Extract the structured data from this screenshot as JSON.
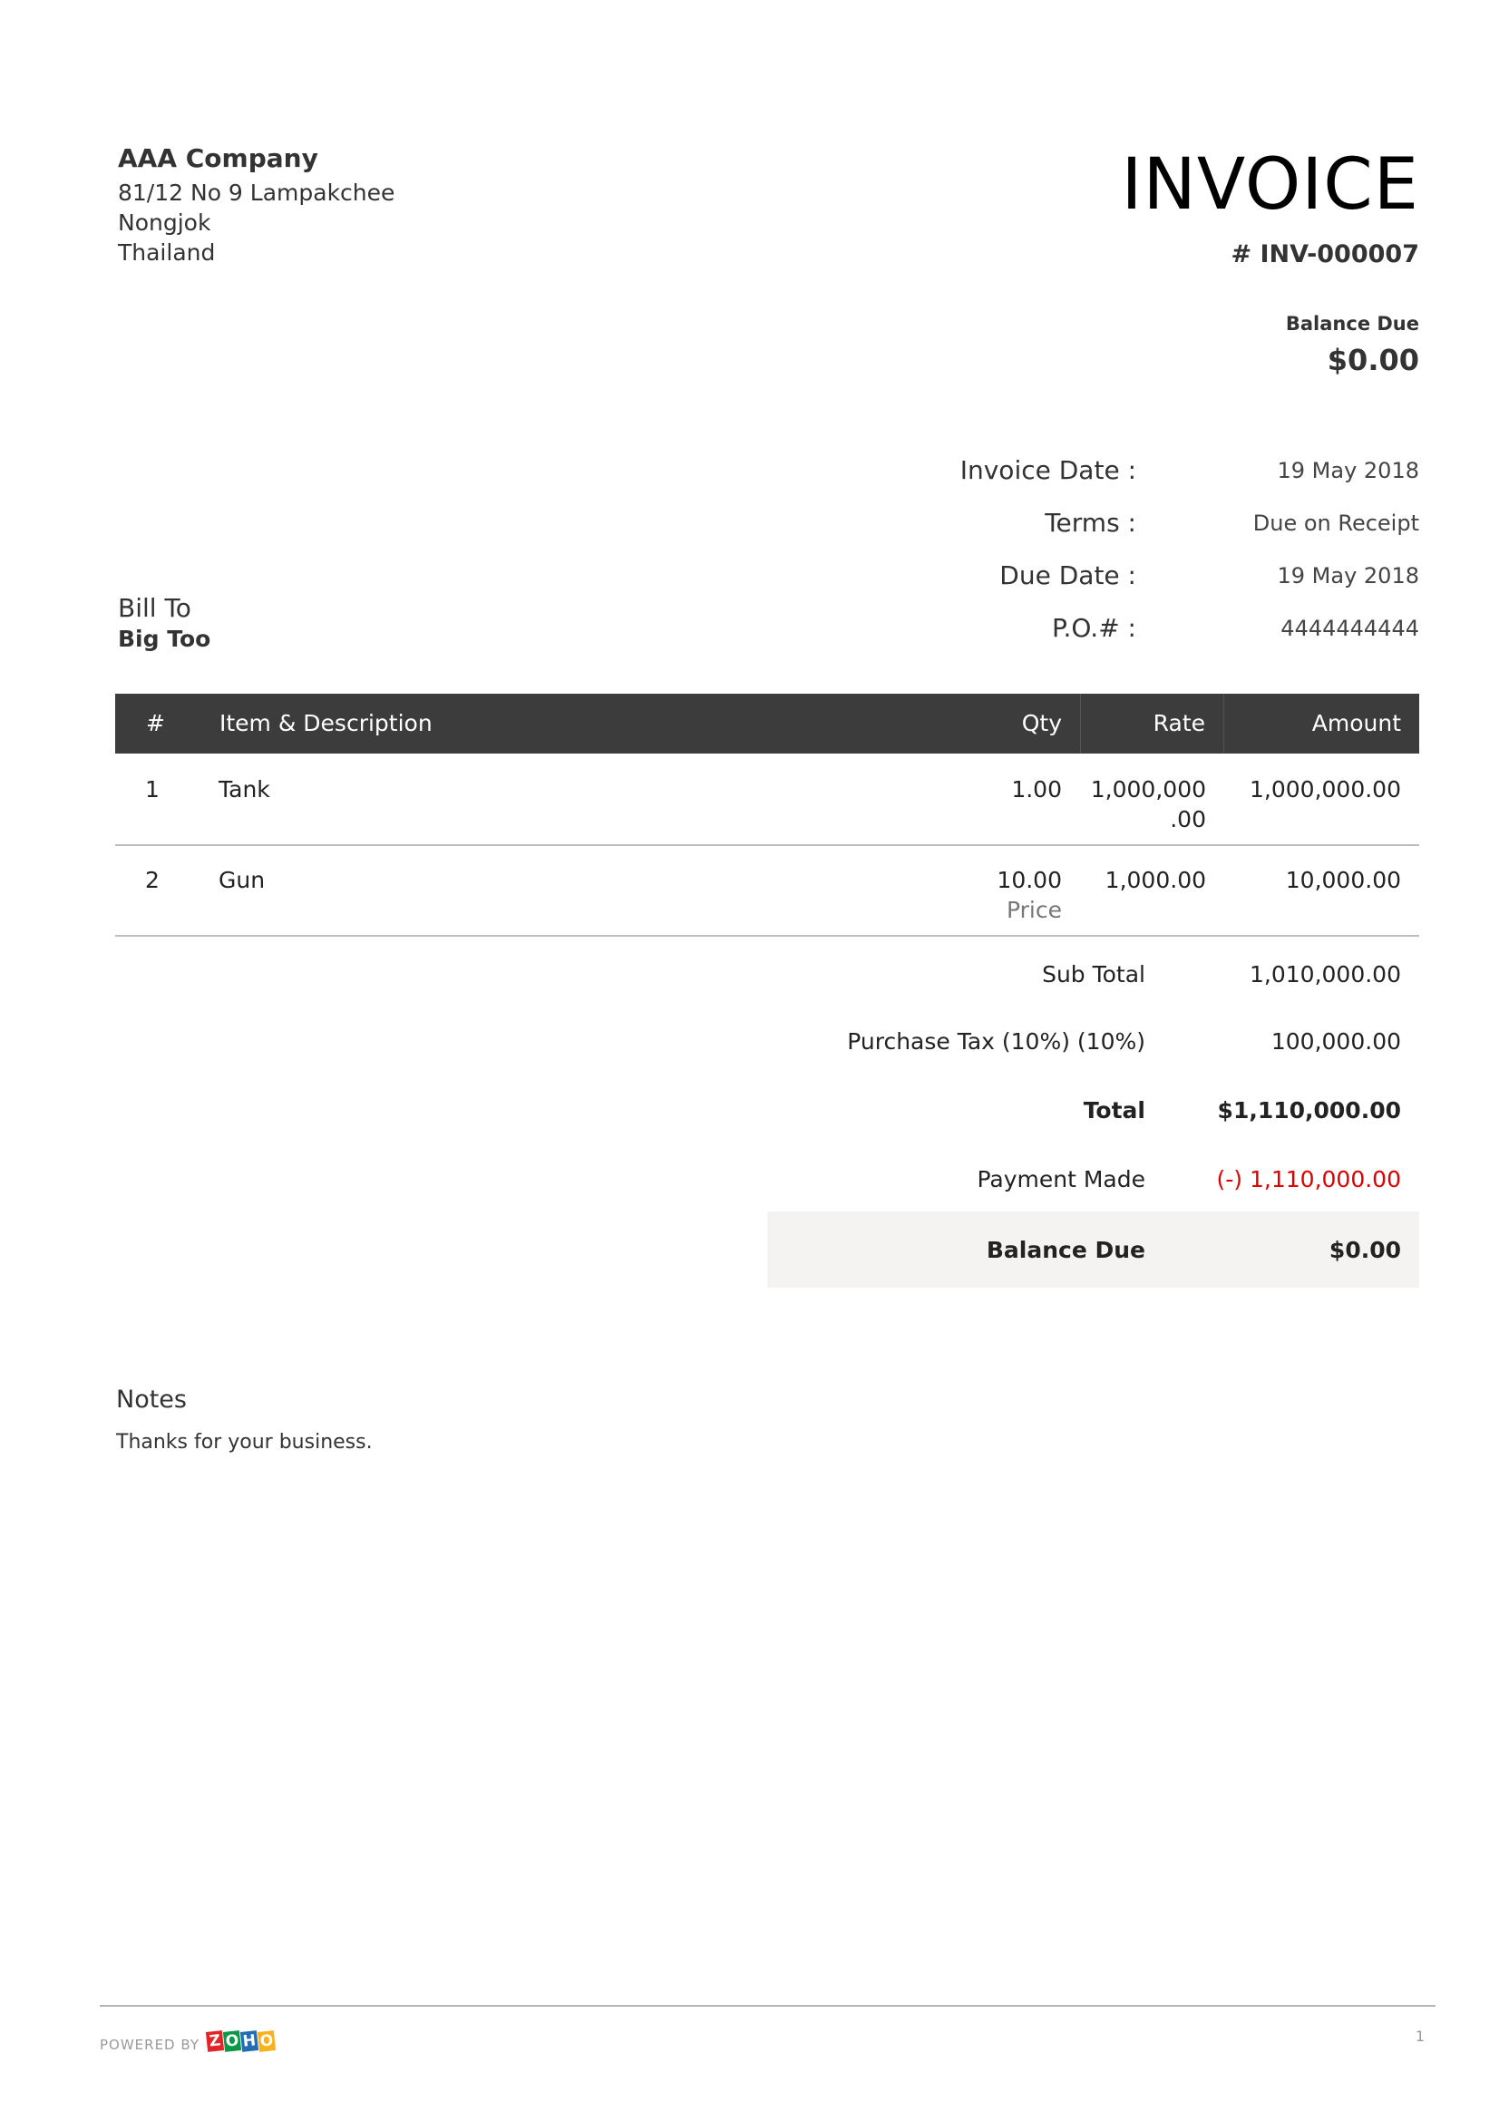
{
  "company": {
    "name": "AAA Company",
    "address_lines": [
      "81/12 No 9 Lampakchee",
      "Nongjok",
      "Thailand"
    ]
  },
  "invoice": {
    "title": "INVOICE",
    "number": "# INV-000007",
    "balance_due_label": "Balance Due",
    "balance_due_amount": "$0.00"
  },
  "meta": [
    {
      "label": "Invoice Date :",
      "value": "19 May 2018"
    },
    {
      "label": "Terms :",
      "value": "Due on Receipt"
    },
    {
      "label": "Due Date :",
      "value": "19 May 2018"
    },
    {
      "label": "P.O.# :",
      "value": "4444444444"
    }
  ],
  "bill_to": {
    "label": "Bill To",
    "name": "Big Too"
  },
  "table": {
    "headers": {
      "num": "#",
      "item": "Item & Description",
      "qty": "Qty",
      "rate": "Rate",
      "amount": "Amount"
    },
    "rows": [
      {
        "num": "1",
        "item": "Tank",
        "qty": "1.00",
        "qty_unit": "",
        "rate_line1": "1,000,000",
        "rate_line2": ".00",
        "amount": "1,000,000.00"
      },
      {
        "num": "2",
        "item": "Gun",
        "qty": "10.00",
        "qty_unit": "Price",
        "rate_line1": "1,000.00",
        "rate_line2": "",
        "amount": "10,000.00"
      }
    ]
  },
  "totals": {
    "sub_total_label": "Sub Total",
    "sub_total_value": "1,010,000.00",
    "tax_label": "Purchase Tax (10%) (10%)",
    "tax_value": "100,000.00",
    "total_label": "Total",
    "total_value": "$1,110,000.00",
    "payment_label": "Payment Made",
    "payment_value": "(-) 1,110,000.00",
    "balance_label": "Balance Due",
    "balance_value": "$0.00"
  },
  "notes": {
    "label": "Notes",
    "text": "Thanks for your business."
  },
  "footer": {
    "powered_by": "POWERED BY",
    "logo_letters": [
      "Z",
      "O",
      "H",
      "O"
    ],
    "logo_colors": [
      "#e42527",
      "#089949",
      "#226db4",
      "#f9b21d"
    ],
    "page_number": "1"
  }
}
